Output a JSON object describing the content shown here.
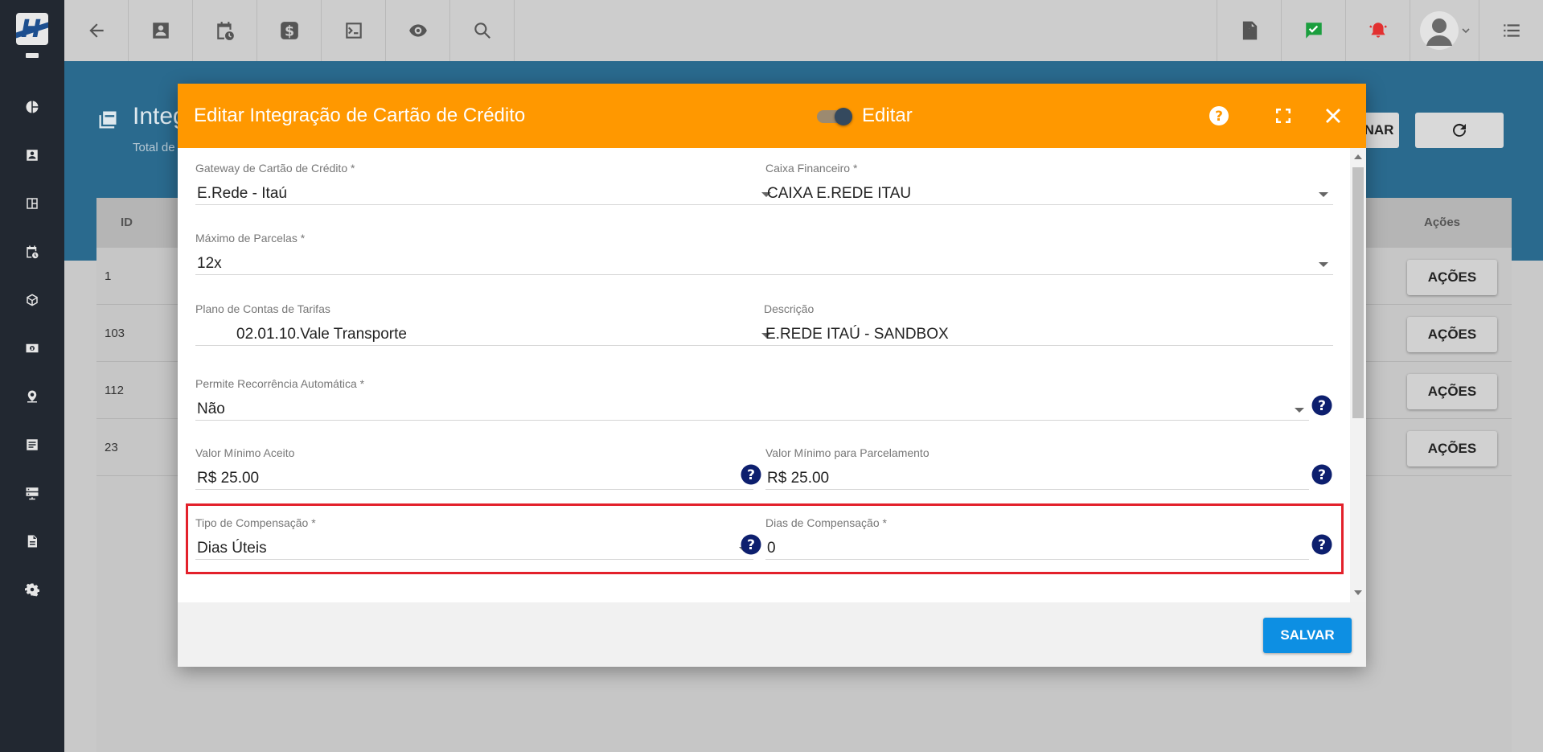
{
  "page": {
    "title": "Integ",
    "subtitle": "Total de",
    "refresh_button_label": "NAR"
  },
  "table": {
    "col_id": "ID",
    "col_actions": "Ações",
    "rows": [
      {
        "id": "1",
        "action": "AÇÕES"
      },
      {
        "id": "103",
        "action": "AÇÕES"
      },
      {
        "id": "112",
        "action": "AÇÕES"
      },
      {
        "id": "23",
        "action": "AÇÕES"
      }
    ]
  },
  "modal": {
    "title": "Editar Integração de Cartão de Crédito",
    "toggle_label": "Editar",
    "save_label": "SALVAR",
    "fields": {
      "gateway": {
        "label": "Gateway de Cartão de Crédito *",
        "value": "E.Rede - Itaú"
      },
      "caixa": {
        "label": "Caixa Financeiro *",
        "value": "CAIXA E.REDE ITAU"
      },
      "parcelas": {
        "label": "Máximo de Parcelas *",
        "value": "12x"
      },
      "plano": {
        "label": "Plano de Contas de Tarifas",
        "value": "02.01.10.Vale Transporte"
      },
      "descricao": {
        "label": "Descrição",
        "value": "E.REDE ITAÚ - SANDBOX"
      },
      "recorrencia": {
        "label": "Permite Recorrência Automática *",
        "value": "Não"
      },
      "valor_min": {
        "label": "Valor Mínimo Aceito",
        "value": "R$ 25.00"
      },
      "valor_min_parc": {
        "label": "Valor Mínimo para Parcelamento",
        "value": "R$ 25.00"
      },
      "tipo_comp": {
        "label": "Tipo de Compensação *",
        "value": "Dias Úteis"
      },
      "dias_comp": {
        "label": "Dias de Compensação *",
        "value": "0"
      }
    }
  },
  "colors": {
    "modal_header": "#ff9800",
    "save_button": "#0d8fe3",
    "help_icon": "#0d1f6e",
    "highlight": "#e3212b",
    "sidebar": "#222831"
  }
}
